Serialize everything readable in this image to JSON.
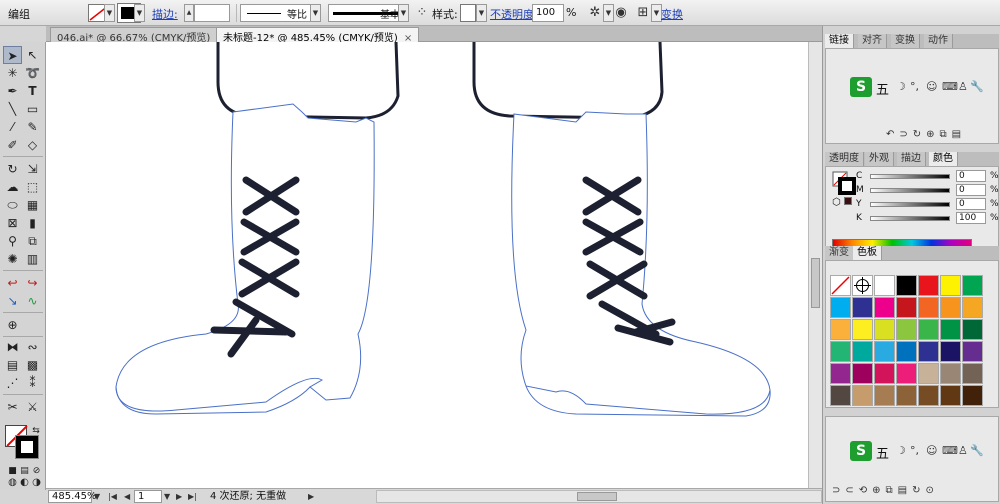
{
  "control_bar": {
    "mode": "编组",
    "stroke_link": "描边:",
    "ratio_label": "等比",
    "profile_label": "基本",
    "style_label": "样式:",
    "opacity_link": "不透明度:",
    "opacity_value": "100",
    "opacity_unit": "%",
    "transform_link": "变换"
  },
  "tabs": [
    {
      "label": "046.ai* @ 66.67% (CMYK/预览)"
    },
    {
      "label": "未标题-12* @ 485.45% (CMYK/预览)",
      "close": "×"
    }
  ],
  "status": {
    "zoom": "485.45%",
    "page": "1",
    "message": "4 次还原; 无重做"
  },
  "panels": {
    "top_tabs": [
      "链接",
      "对齐",
      "变换",
      "动作"
    ],
    "ime": {
      "logo": "S",
      "text": "五"
    },
    "color_tabs": [
      "透明度",
      "外观",
      "描边",
      "颜色"
    ],
    "cmyk": [
      {
        "ch": "C",
        "value": "0",
        "unit": "%"
      },
      {
        "ch": "M",
        "value": "0",
        "unit": "%"
      },
      {
        "ch": "Y",
        "value": "0",
        "unit": "%"
      },
      {
        "ch": "K",
        "value": "100",
        "unit": "%"
      }
    ],
    "swatch_tabs": [
      "渐变",
      "色板"
    ],
    "swatch_colors": [
      "#ffffff",
      "#ffffff",
      "#ffffff",
      "#000000",
      "#e8161c",
      "#fff200",
      "#00a551",
      "#00aeef",
      "#2e3192",
      "#ec008c",
      "#c4161c",
      "#f26522",
      "#f7941d",
      "#f5a623",
      "#fbb03b",
      "#fcee21",
      "#d9e021",
      "#8cc63f",
      "#39b54a",
      "#009245",
      "#006837",
      "#22b573",
      "#00a99d",
      "#29abe2",
      "#0071bc",
      "#2e3192",
      "#1b1464",
      "#662d91",
      "#93278f",
      "#9e005d",
      "#d4145a",
      "#ed1e79",
      "#c7b299",
      "#998675",
      "#736357",
      "#534741",
      "#c69c6d",
      "#a67c52",
      "#8c6239",
      "#754c24",
      "#603813",
      "#42210b",
      "#f2f2f2",
      "#e6e6e6",
      "#b3b3b3",
      "#808080",
      "#666666",
      "#4d4d4d",
      "#333333"
    ]
  }
}
